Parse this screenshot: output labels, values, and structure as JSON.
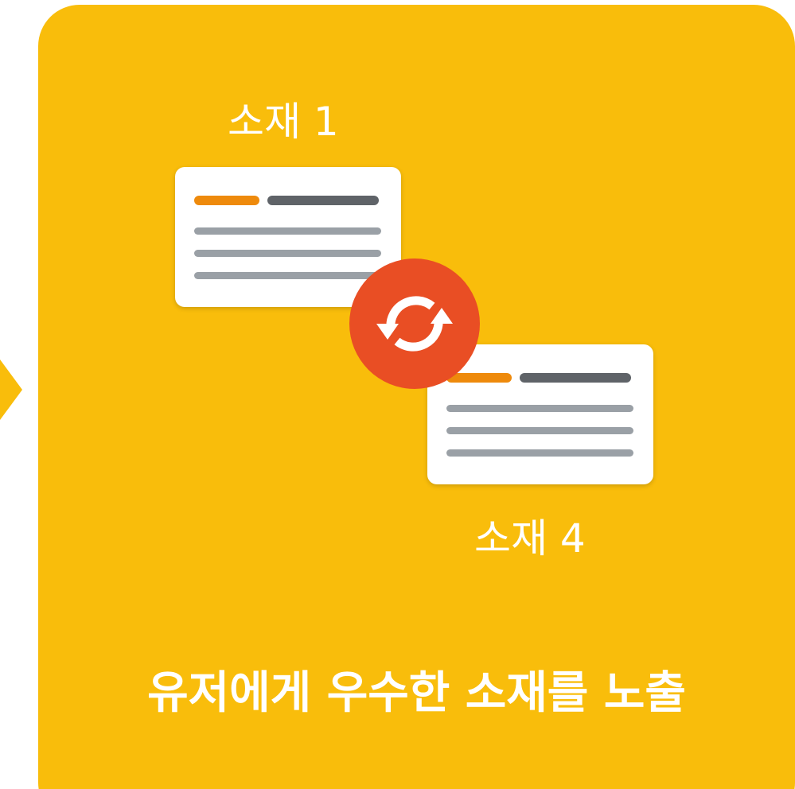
{
  "diagram": {
    "items": [
      {
        "label": "소재 1"
      },
      {
        "label": "소재 4"
      }
    ],
    "caption": "유저에게 우수한 소재를 노출",
    "icons": {
      "swap": "sync-icon",
      "pointer": "arrow-right-icon"
    },
    "colors": {
      "panel": "#f9bd0b",
      "sync_circle": "#e94e24",
      "card_accent": "#ee8a0c",
      "card_dark_bar": "#5f6368",
      "card_line": "#9aa0a6",
      "text": "#ffffff"
    }
  }
}
